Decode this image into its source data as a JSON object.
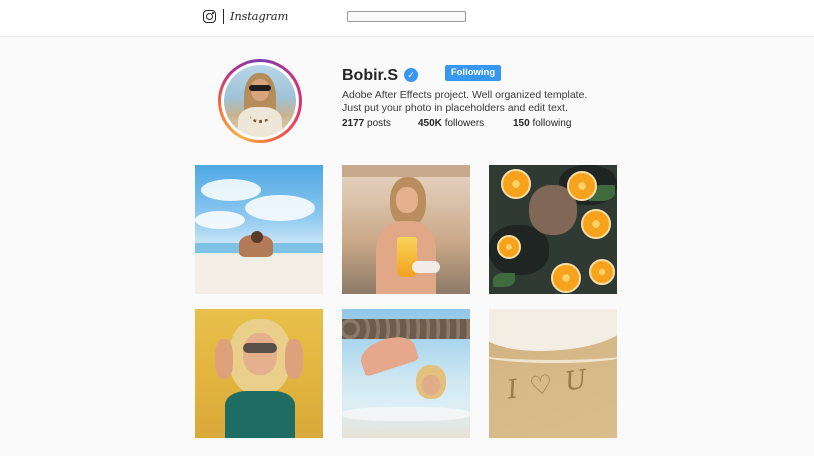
{
  "header": {
    "brand": "Instagram",
    "search_placeholder": ""
  },
  "profile": {
    "username": "Bobir.S",
    "verified": true,
    "follow_button": "Following",
    "bio_line1": "Adobe After Effects project. Well organized template.",
    "bio_line2": "Just put your photo in placeholders and edit text.",
    "stats": {
      "posts_count": "2177",
      "posts_label": "posts",
      "followers_count": "450K",
      "followers_label": "followers",
      "following_count": "150",
      "following_label": "following"
    }
  },
  "colors": {
    "accent": "#3897f0",
    "background": "#fafafa",
    "text": "#262626"
  },
  "icons": {
    "logo": "instagram-glyph-icon",
    "verified": "verified-badge-icon"
  }
}
